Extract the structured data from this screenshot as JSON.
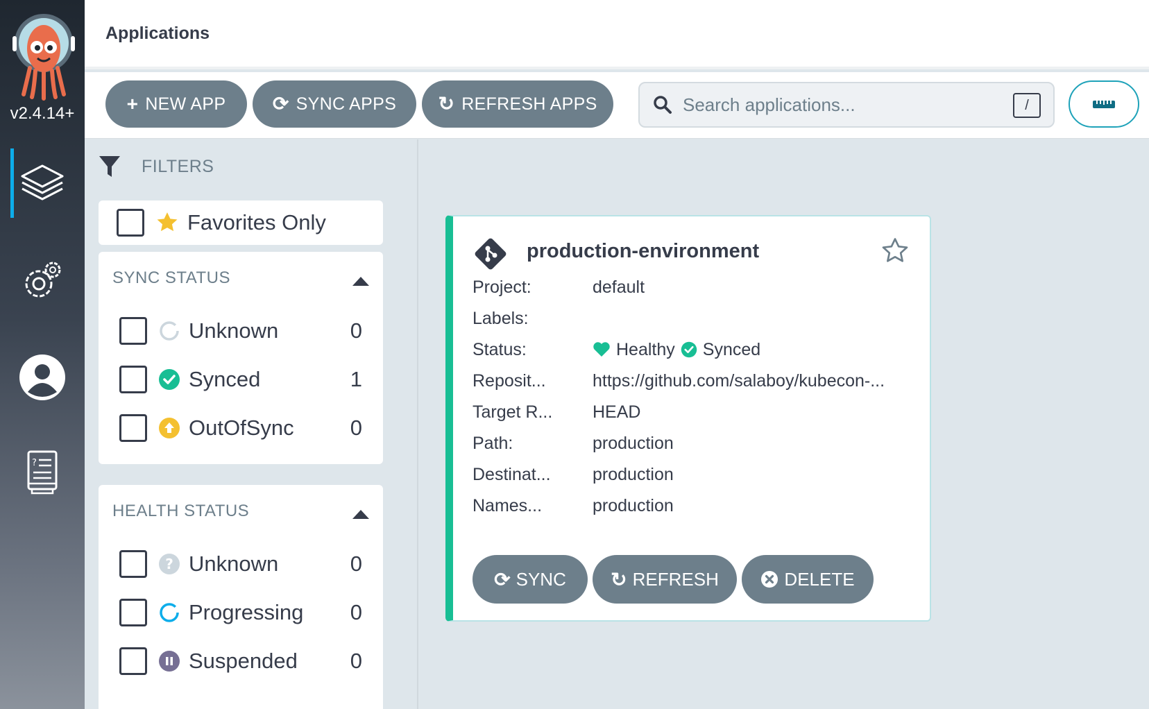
{
  "nav": {
    "version": "v2.4.14+",
    "items": [
      {
        "name": "applications",
        "icon": "layers-icon"
      },
      {
        "name": "settings",
        "icon": "gears-icon"
      },
      {
        "name": "user-info",
        "icon": "user-icon"
      },
      {
        "name": "docs",
        "icon": "book-icon"
      }
    ]
  },
  "header": {
    "title": "Applications"
  },
  "toolbar": {
    "new_app": "NEW APP",
    "sync_apps": "SYNC APPS",
    "refresh_apps": "REFRESH APPS",
    "search_placeholder": "Search applications...",
    "search_shortcut": "/"
  },
  "filters": {
    "title": "FILTERS",
    "favorites_label": "Favorites Only",
    "sync_status": {
      "title": "SYNC STATUS",
      "items": [
        {
          "label": "Unknown",
          "count": "0",
          "color": "#ccd6dd"
        },
        {
          "label": "Synced",
          "count": "1",
          "color": "#18be94"
        },
        {
          "label": "OutOfSync",
          "count": "0",
          "color": "#f4c030"
        }
      ]
    },
    "health_status": {
      "title": "HEALTH STATUS",
      "items": [
        {
          "label": "Unknown",
          "count": "0",
          "color": "#ccd6dd"
        },
        {
          "label": "Progressing",
          "count": "0",
          "color": "#0dadea"
        },
        {
          "label": "Suspended",
          "count": "0",
          "color": "#766f94"
        }
      ]
    }
  },
  "app": {
    "name": "production-environment",
    "fields": [
      {
        "key": "Project:",
        "value": "default"
      },
      {
        "key": "Labels:",
        "value": ""
      },
      {
        "key": "Status:",
        "health": "Healthy",
        "sync": "Synced"
      },
      {
        "key": "Reposit...",
        "value": "https://github.com/salaboy/kubecon-..."
      },
      {
        "key": "Target R...",
        "value": "HEAD"
      },
      {
        "key": "Path:",
        "value": "production"
      },
      {
        "key": "Destinat...",
        "value": "production"
      },
      {
        "key": "Names...",
        "value": "production"
      }
    ],
    "actions": {
      "sync": "SYNC",
      "refresh": "REFRESH",
      "delete": "DELETE"
    }
  },
  "colors": {
    "healthy": "#18be94",
    "synced": "#18be94",
    "button": "#6d7f8b",
    "accent": "#0dadea"
  }
}
